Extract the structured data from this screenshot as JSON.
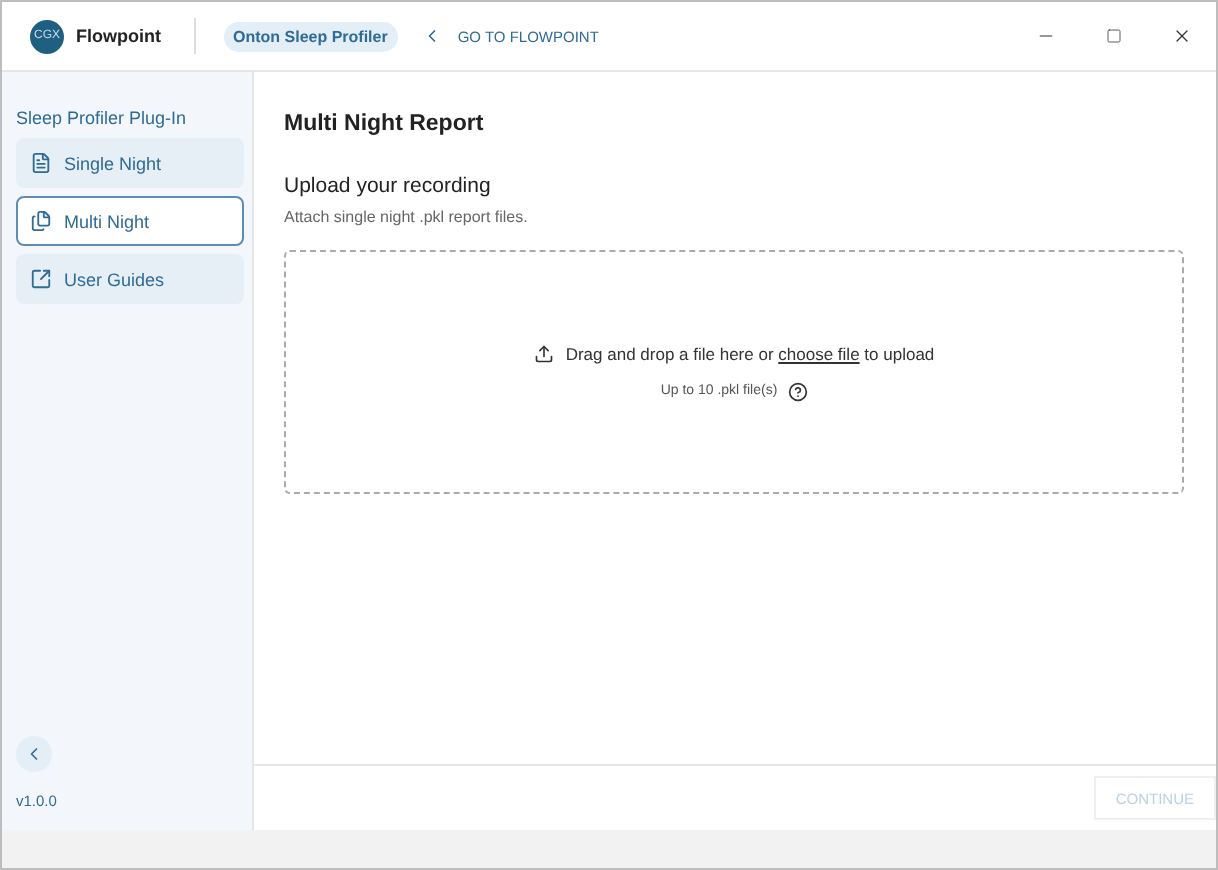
{
  "header": {
    "logo_text": "CGX",
    "app_name": "Flowpoint",
    "product_badge": "Onton Sleep Profiler",
    "back_link": "GO TO FLOWPOINT"
  },
  "sidebar": {
    "title": "Sleep Profiler Plug-In",
    "items": [
      {
        "label": "Single Night",
        "selected": false
      },
      {
        "label": "Multi Night",
        "selected": true
      },
      {
        "label": "User Guides",
        "selected": false
      }
    ],
    "version": "v1.0.0"
  },
  "main": {
    "title": "Multi Night Report",
    "section_title": "Upload your recording",
    "section_hint": "Attach single night .pkl report files.",
    "dropzone": {
      "text_before": "Drag and drop a file here or",
      "link": "choose file",
      "text_after": "to upload",
      "limit": "Up to 10 .pkl file(s)"
    }
  },
  "footer": {
    "continue_button": {
      "label": "CONTINUE",
      "disabled": true
    }
  }
}
